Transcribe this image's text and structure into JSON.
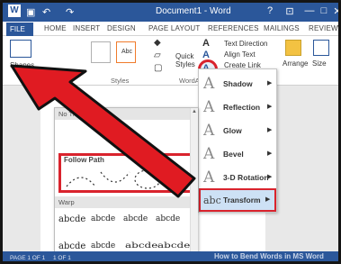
{
  "titlebar": {
    "doc_title": "Document1 - Word",
    "help": "?",
    "minimize": "—",
    "restore": "□",
    "close": "✕",
    "undo": "↶",
    "redo": "↷"
  },
  "tabs": {
    "file": "FILE",
    "home": "HOME",
    "insert": "INSERT",
    "design": "DESIGN",
    "page_layout": "PAGE LAYOUT",
    "references": "REFERENCES",
    "mailings": "MAILINGS",
    "review": "REVIEW",
    "view": "V"
  },
  "ribbon": {
    "shapes": "Shapes",
    "abc": "Abc",
    "quick_styles": "Quick Styles",
    "text_direction": "Text Direction",
    "align_text": "Align Text",
    "create_link": "Create Link",
    "arrange": "Arrange",
    "size": "Size",
    "group_styles": "Styles",
    "group_wordart": "WordArt"
  },
  "menu": {
    "items": [
      {
        "label": "Shadow",
        "icon": "A"
      },
      {
        "label": "Reflection",
        "icon": "A"
      },
      {
        "label": "Glow",
        "icon": "A"
      },
      {
        "label": "Bevel",
        "icon": "A"
      },
      {
        "label": "3-D Rotation",
        "icon": "A"
      },
      {
        "label": "Transform",
        "icon": "abc"
      }
    ]
  },
  "submenu": {
    "no_transform": "No Transform",
    "follow_path": "Follow Path",
    "warp": "Warp",
    "warp_row1": [
      "abcde",
      "abcde",
      "abcde",
      "abcde"
    ],
    "warp_row2": [
      "abcde",
      "abcde",
      "abcde",
      "abcde"
    ]
  },
  "status": {
    "page": "PAGE 1 OF 1",
    "words": "1 OF 1"
  },
  "watermark": "How to Bend Words in MS Word",
  "colors": {
    "accent": "#2b579a",
    "highlight": "#d9232d"
  }
}
